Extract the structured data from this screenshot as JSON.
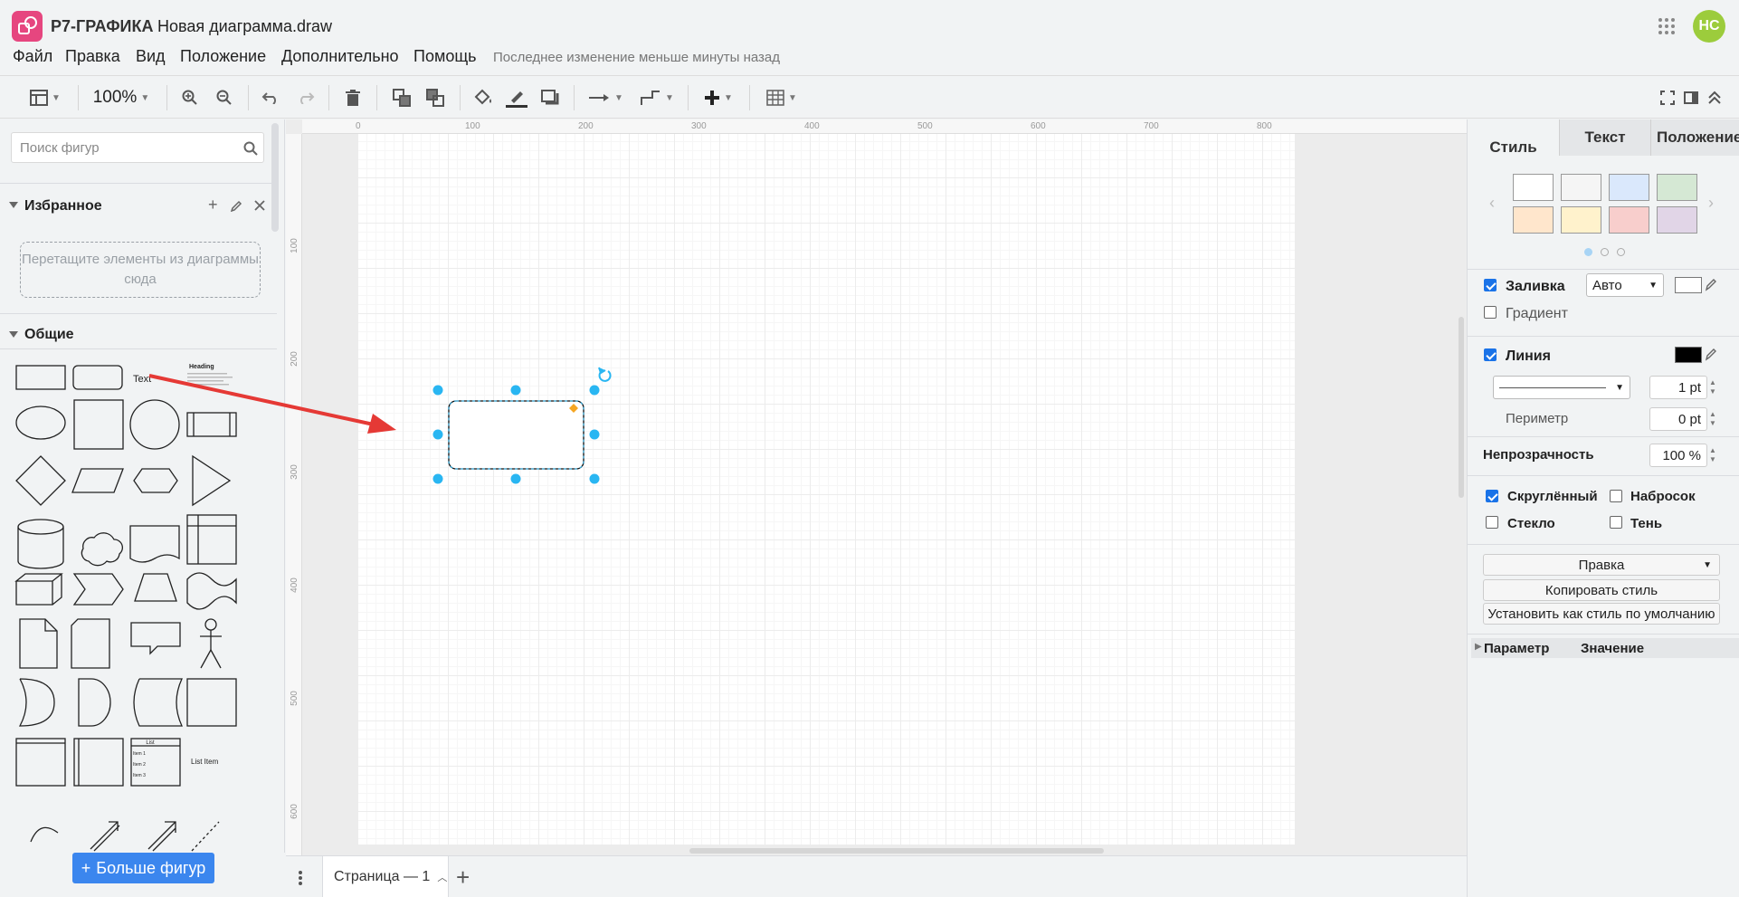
{
  "app": {
    "name": "Р7-ГРАФИКА",
    "doc_title": "Новая диаграмма.draw",
    "user_initials": "НС"
  },
  "menu": {
    "items": [
      "Файл",
      "Правка",
      "Вид",
      "Положение",
      "Дополнительно",
      "Помощь"
    ],
    "last_change": "Последнее изменение меньше минуты назад"
  },
  "toolbar": {
    "zoom": "100%"
  },
  "left": {
    "search_placeholder": "Поиск фигур",
    "favorites": "Избранное",
    "dropzone": "Перетащите элементы из диаграммы сюда",
    "general": "Общие",
    "shape_text": "Text",
    "shape_heading": "Heading",
    "shape_list": "List",
    "shape_list_item": "List Item",
    "list_items": [
      "Item 1",
      "Item 2",
      "Item 3"
    ],
    "more_shapes": "Больше фигур"
  },
  "ruler": {
    "top": [
      "0",
      "100",
      "200",
      "300",
      "400",
      "500",
      "600",
      "700",
      "800"
    ],
    "left": [
      "100",
      "200",
      "300",
      "400",
      "500",
      "600"
    ]
  },
  "bottom": {
    "page_tab": "Страница — 1"
  },
  "right": {
    "tabs": [
      "Стиль",
      "Текст",
      "Положение"
    ],
    "swatch_colors": [
      "#ffffff",
      "#f5f5f5",
      "#dae8fc",
      "#d5e8d4",
      "#ffe6cc",
      "#fff2cc",
      "#f8cecc",
      "#e1d5e7"
    ],
    "fill": "Заливка",
    "fill_mode": "Авто",
    "gradient": "Градиент",
    "line": "Линия",
    "line_width": "1 pt",
    "perimeter": "Периметр",
    "perimeter_value": "0 pt",
    "opacity": "Непрозрачность",
    "opacity_value": "100 %",
    "rounded": "Скруглённый",
    "sketch": "Набросок",
    "glass": "Стекло",
    "shadow": "Тень",
    "edit": "Правка",
    "copy_style": "Копировать стиль",
    "set_default": "Установить как стиль по умолчанию",
    "param": "Параметр",
    "value": "Значение"
  },
  "colors": {
    "accent": "#e6467f",
    "selection": "#29b6f2",
    "arrow": "#e53935",
    "avatar": "#9ccc3c"
  }
}
